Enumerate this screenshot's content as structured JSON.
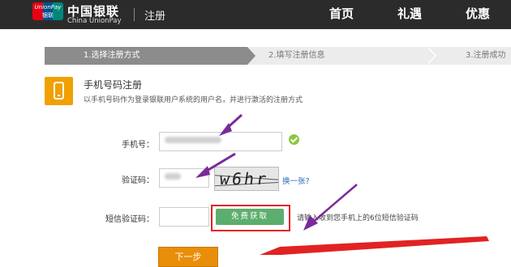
{
  "header": {
    "logo_badge_line1": "UnionPay",
    "logo_badge_line2": "银联",
    "logo_cn": "中国银联",
    "logo_en": "China UnionPay",
    "page_title": "注册",
    "nav": [
      "首页",
      "礼遇",
      "优惠"
    ]
  },
  "steps": [
    {
      "label": "1.选择注册方式",
      "active": true
    },
    {
      "label": "2.填写注册信息",
      "active": false
    },
    {
      "label": "3.注册成功",
      "active": false
    }
  ],
  "method": {
    "title": "手机号码注册",
    "description": "以手机号码作为登录银联用户系统的用户名，并进行激活的注册方式",
    "icon": "mobile-phone-icon"
  },
  "form": {
    "phone_label": "手机号：",
    "captcha_label": "验证码：",
    "captcha_image_text": "w6hr",
    "captcha_refresh": "换一张?",
    "sms_label": "短信验证码：",
    "sms_button": "免费获取",
    "sms_hint": "请输入收到您手机上的6位短信验证码",
    "next_button": "下一步"
  },
  "colors": {
    "header_bg": "#2b2b2b",
    "step_active": "#8c8c8c",
    "step_inactive": "#ececec",
    "accent_orange": "#e98e08",
    "sms_button": "#5cae6e",
    "highlight_red": "#e22222",
    "annotation_purple": "#7a2a9a"
  }
}
